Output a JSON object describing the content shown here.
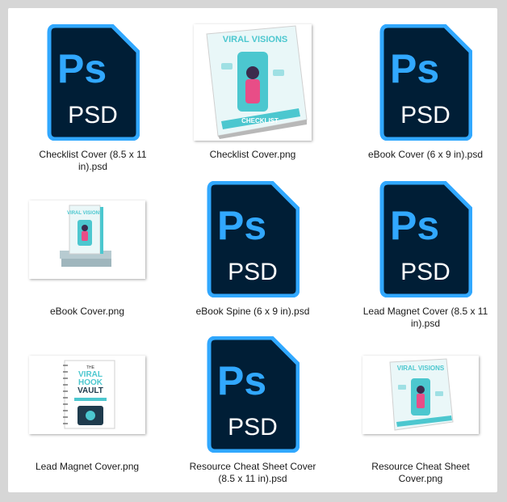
{
  "icon": {
    "badge": "Ps",
    "ext": "PSD"
  },
  "mock_text": {
    "checklist_title": "VIRAL VISIONS",
    "checklist_footer": "CHECKLIST",
    "ebook_title": "VIRAL VISIONS",
    "lead_line1": "THE",
    "lead_line2": "VIRAL",
    "lead_line3": "HOOK",
    "lead_line4": "VAULT",
    "cheat_title": "VIRAL VISIONS"
  },
  "files": [
    {
      "label": "Checklist Cover (8.5 x 11 in).psd"
    },
    {
      "label": "Checklist Cover.png"
    },
    {
      "label": "eBook Cover (6 x 9 in).psd"
    },
    {
      "label": "eBook Cover.png"
    },
    {
      "label": "eBook Spine (6 x 9 in).psd"
    },
    {
      "label": "Lead Magnet Cover (8.5 x 11 in).psd"
    },
    {
      "label": "Lead Magnet Cover.png"
    },
    {
      "label": "Resource Cheat Sheet Cover (8.5 x 11 in).psd"
    },
    {
      "label": "Resource Cheat Sheet Cover.png"
    }
  ],
  "colors": {
    "psd_bg": "#001e36",
    "psd_accent": "#31a8ff",
    "teal": "#4cc7cf"
  }
}
